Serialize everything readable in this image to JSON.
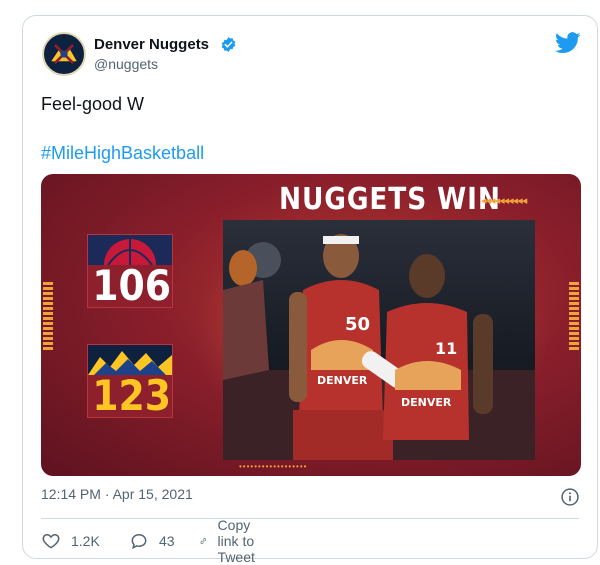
{
  "tweet": {
    "author": {
      "display_name": "Denver Nuggets",
      "handle": "@nuggets",
      "verified": true
    },
    "text": "Feel-good W",
    "hashtag": "#MileHighBasketball",
    "timestamp": "12:14 PM · Apr 15, 2021"
  },
  "media": {
    "headline": "NUGGETS WIN",
    "chevrons": "◂◂◂◂◂◂◂◂◂◂",
    "bottom_dots": "••••••••••••••••••",
    "scores": [
      {
        "team_logo": "heat-logo",
        "score": "106"
      },
      {
        "team_logo": "nuggets-mountains-logo",
        "score": "123"
      }
    ],
    "players": [
      {
        "jersey_name": "DENVER",
        "number": "50"
      },
      {
        "jersey_name": "DENVER",
        "number": "11"
      }
    ]
  },
  "actions": {
    "likes": "1.2K",
    "replies": "43",
    "copy_link": "Copy link to Tweet"
  },
  "colors": {
    "brand_blue": "#1d9bf0",
    "media_red": "#8a1f2b",
    "gold": "#fec524",
    "text_gray": "#536471"
  }
}
